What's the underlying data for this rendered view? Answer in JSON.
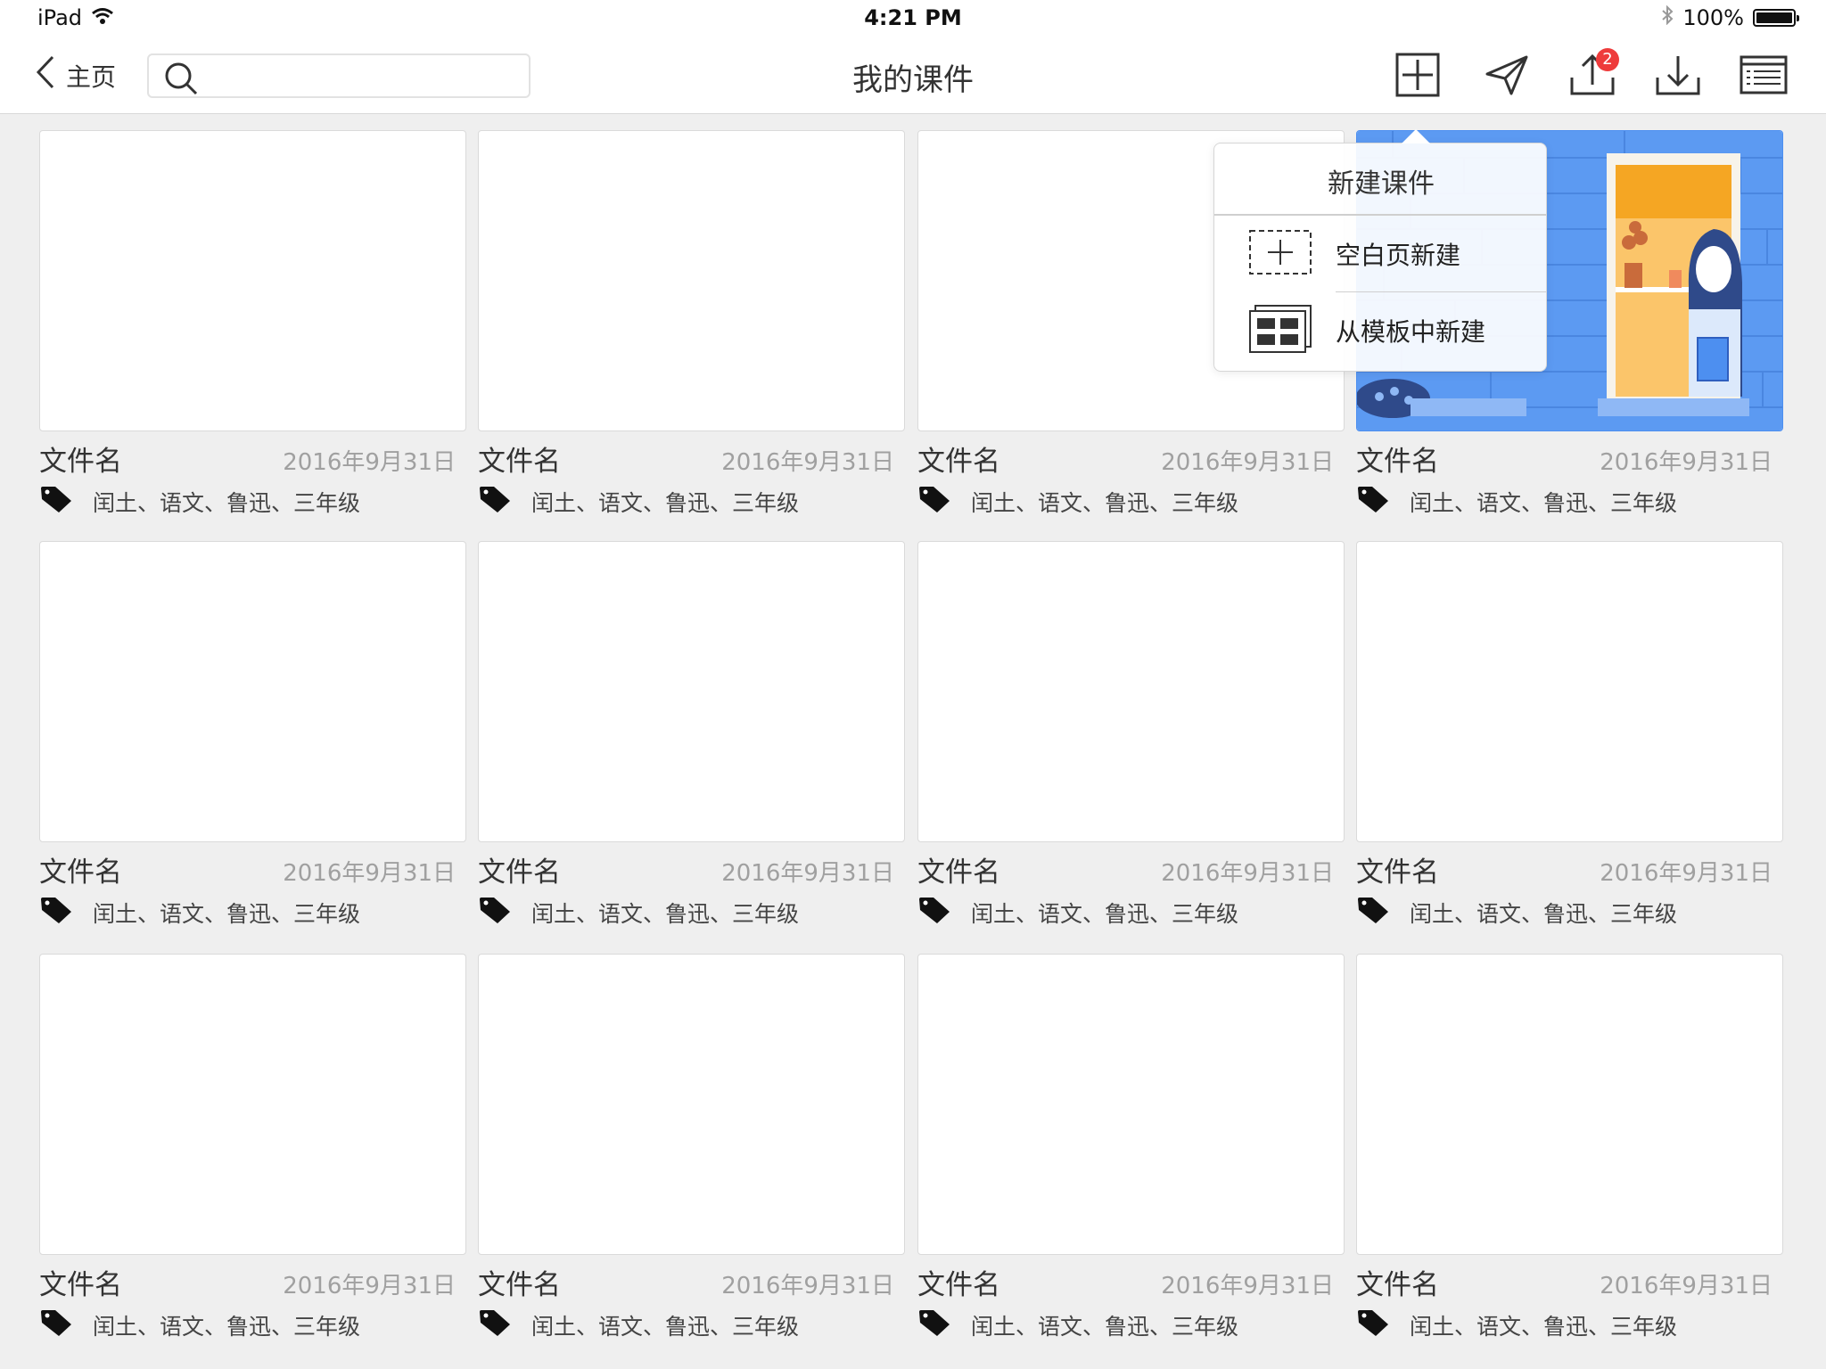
{
  "status": {
    "device": "iPad",
    "time": "4:21 PM",
    "battery": "100%"
  },
  "nav": {
    "back_label": "主页",
    "search_placeholder": "",
    "title": "我的课件",
    "upload_badge": "2"
  },
  "popover": {
    "title": "新建课件",
    "items": [
      {
        "label": "空白页新建",
        "icon": "dashed-plus-icon"
      },
      {
        "label": "从模板中新建",
        "icon": "template-grid-icon"
      }
    ]
  },
  "files": [
    {
      "name": "文件名",
      "date": "2016年9月31日",
      "tags": "闰土、语文、鲁迅、三年级"
    },
    {
      "name": "文件名",
      "date": "2016年9月31日",
      "tags": "闰土、语文、鲁迅、三年级"
    },
    {
      "name": "文件名",
      "date": "2016年9月31日",
      "tags": "闰土、语文、鲁迅、三年级"
    },
    {
      "name": "文件名",
      "date": "2016年9月31日",
      "tags": "闰土、语文、鲁迅、三年级",
      "thumbnail": "illustration"
    },
    {
      "name": "文件名",
      "date": "2016年9月31日",
      "tags": "闰土、语文、鲁迅、三年级"
    },
    {
      "name": "文件名",
      "date": "2016年9月31日",
      "tags": "闰土、语文、鲁迅、三年级"
    },
    {
      "name": "文件名",
      "date": "2016年9月31日",
      "tags": "闰土、语文、鲁迅、三年级"
    },
    {
      "name": "文件名",
      "date": "2016年9月31日",
      "tags": "闰土、语文、鲁迅、三年级"
    },
    {
      "name": "文件名",
      "date": "2016年9月31日",
      "tags": "闰土、语文、鲁迅、三年级"
    },
    {
      "name": "文件名",
      "date": "2016年9月31日",
      "tags": "闰土、语文、鲁迅、三年级"
    },
    {
      "name": "文件名",
      "date": "2016年9月31日",
      "tags": "闰土、语文、鲁迅、三年级"
    },
    {
      "name": "文件名",
      "date": "2016年9月31日",
      "tags": "闰土、语文、鲁迅、三年级"
    }
  ],
  "colors": {
    "accent_blue": "#4d8ff0",
    "badge_red": "#ee3b3b",
    "illustration_orange": "#f5a623"
  }
}
